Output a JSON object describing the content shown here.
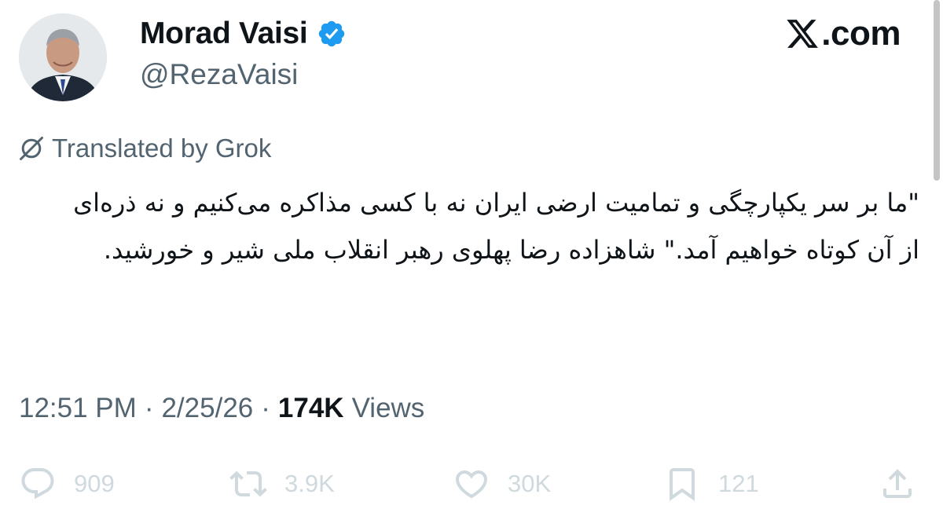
{
  "author": {
    "display_name": "Morad Vaisi",
    "handle": "@RezaVaisi",
    "verified": true,
    "avatar_icon": "profile-photo"
  },
  "brand": {
    "text": ".com",
    "icon": "x-logo-icon"
  },
  "translation": {
    "label": "Translated by Grok",
    "icon": "grok-icon"
  },
  "tweet": {
    "text": "\"ما بر سر یکپارچگی و تمامیت ارضی ایران نه با کسی مذاکره می‌کنیم  و نه ذره‌ای از آن کوتاه خواهیم آمد.\" شاهزاده رضا پهلوی رهبر انقلاب ملی شیر و خورشید."
  },
  "meta": {
    "time": "12:51 PM",
    "separator": "·",
    "date": "2/25/26",
    "views_count": "174K",
    "views_label": "Views"
  },
  "actions": {
    "replies": {
      "icon": "reply-icon",
      "count": "909"
    },
    "reposts": {
      "icon": "repost-icon",
      "count": "3.9K"
    },
    "likes": {
      "icon": "heart-icon",
      "count": "30K"
    },
    "bookmarks": {
      "icon": "bookmark-icon",
      "count": "121"
    },
    "share": {
      "icon": "share-icon"
    }
  },
  "colors": {
    "text_primary": "#0f1419",
    "text_secondary": "#536471",
    "action_icons": "#cfd9de",
    "verified_badge": "#1d9bf0"
  }
}
